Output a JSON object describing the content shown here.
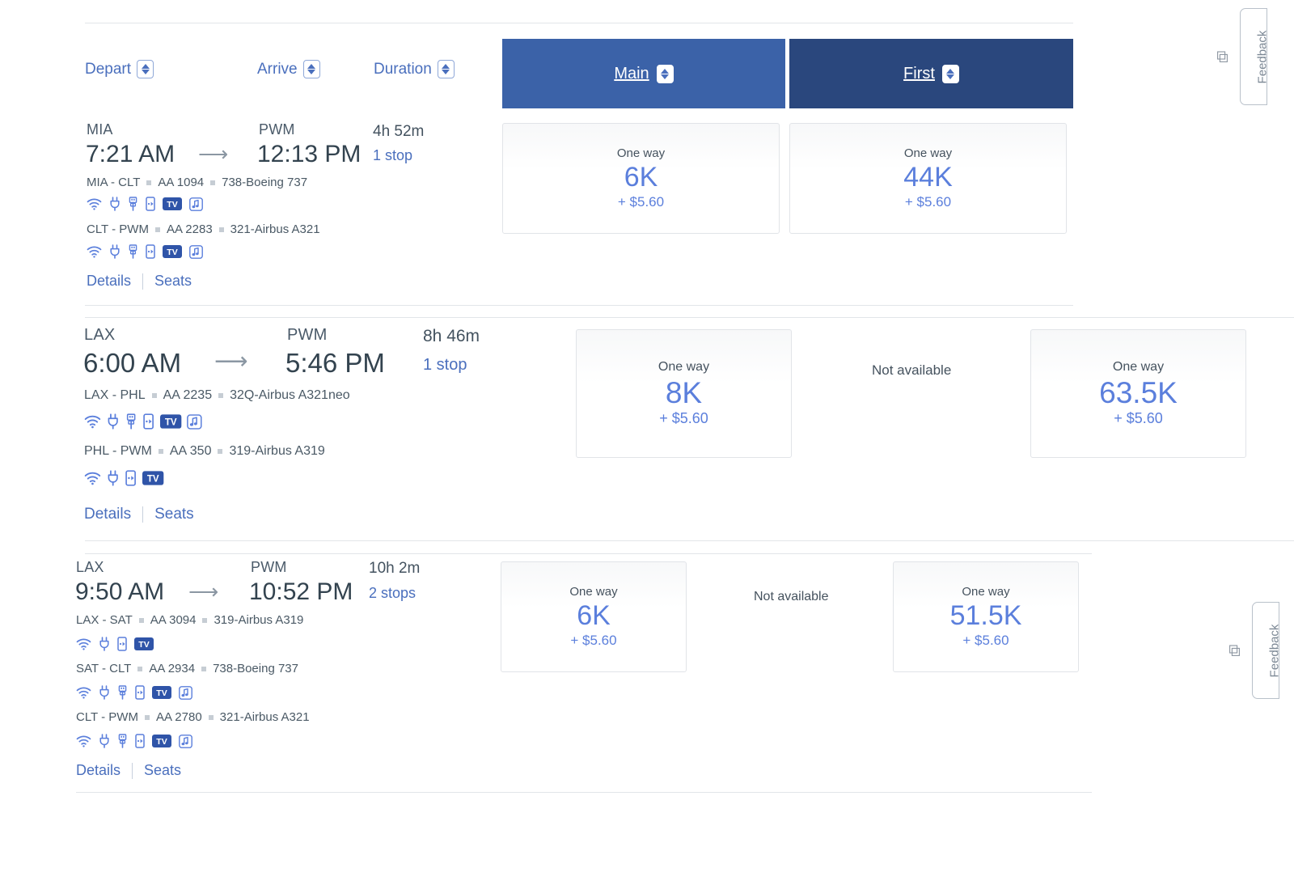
{
  "header": {
    "columns": [
      {
        "label": "Depart",
        "icon": "sort-icon"
      },
      {
        "label": "Arrive",
        "icon": "sort-icon"
      },
      {
        "label": "Duration",
        "icon": "sort-icon"
      }
    ],
    "cabins": [
      {
        "label": "Main",
        "color": "#3b62a8",
        "icon": "sort-icon"
      },
      {
        "label": "First",
        "color": "#2a477d",
        "icon": "sort-icon"
      }
    ]
  },
  "links": {
    "details": "Details",
    "seats": "Seats",
    "one_way": "One way",
    "not_available": "Not available"
  },
  "itineraries": [
    {
      "origin": "MIA",
      "depart_time": "7:21 AM",
      "destination": "PWM",
      "arrive_time": "12:13 PM",
      "duration": "4h 52m",
      "stops": "1 stop",
      "segments": [
        {
          "route": "MIA - CLT",
          "flight": "AA 1094",
          "aircraft": "738-Boeing 737",
          "amenities": [
            "wifi-icon",
            "power-outlet-icon",
            "usb-icon",
            "streaming-device-icon",
            "tv-icon",
            "music-icon"
          ]
        },
        {
          "route": "CLT - PWM",
          "flight": "AA 2283",
          "aircraft": "321-Airbus A321",
          "amenities": [
            "wifi-icon",
            "power-outlet-icon",
            "usb-icon",
            "streaming-device-icon",
            "tv-icon",
            "music-icon"
          ]
        }
      ],
      "fares": [
        {
          "cabin": "Main",
          "available": true,
          "label": "One way",
          "amount": "6K",
          "tax": "+ $5.60"
        },
        {
          "cabin": "First",
          "available": true,
          "label": "One way",
          "amount": "44K",
          "tax": "+ $5.60"
        }
      ]
    },
    {
      "origin": "LAX",
      "depart_time": "6:00 AM",
      "destination": "PWM",
      "arrive_time": "5:46 PM",
      "duration": "8h 46m",
      "stops": "1 stop",
      "segments": [
        {
          "route": "LAX - PHL",
          "flight": "AA 2235",
          "aircraft": "32Q-Airbus A321neo",
          "amenities": [
            "wifi-icon",
            "power-outlet-icon",
            "usb-icon",
            "streaming-device-icon",
            "tv-icon",
            "music-icon"
          ]
        },
        {
          "route": "PHL - PWM",
          "flight": "AA 350",
          "aircraft": "319-Airbus A319",
          "amenities": [
            "wifi-icon",
            "power-outlet-icon",
            "streaming-device-icon",
            "tv-icon"
          ]
        }
      ],
      "fares": [
        {
          "cabin": "Main",
          "available": true,
          "label": "One way",
          "amount": "8K",
          "tax": "+ $5.60"
        },
        {
          "cabin": "",
          "available": false,
          "label": "Not available"
        },
        {
          "cabin": "First",
          "available": true,
          "label": "One way",
          "amount": "63.5K",
          "tax": "+ $5.60"
        }
      ]
    },
    {
      "origin": "LAX",
      "depart_time": "9:50 AM",
      "destination": "PWM",
      "arrive_time": "10:52 PM",
      "duration": "10h 2m",
      "stops": "2 stops",
      "segments": [
        {
          "route": "LAX - SAT",
          "flight": "AA 3094",
          "aircraft": "319-Airbus A319",
          "amenities": [
            "wifi-icon",
            "power-outlet-icon",
            "streaming-device-icon",
            "tv-icon"
          ]
        },
        {
          "route": "SAT - CLT",
          "flight": "AA 2934",
          "aircraft": "738-Boeing 737",
          "amenities": [
            "wifi-icon",
            "power-outlet-icon",
            "usb-icon",
            "streaming-device-icon",
            "tv-icon",
            "music-icon"
          ]
        },
        {
          "route": "CLT - PWM",
          "flight": "AA 2780",
          "aircraft": "321-Airbus A321",
          "amenities": [
            "wifi-icon",
            "power-outlet-icon",
            "usb-icon",
            "streaming-device-icon",
            "tv-icon",
            "music-icon"
          ]
        }
      ],
      "fares": [
        {
          "cabin": "Main",
          "available": true,
          "label": "One way",
          "amount": "6K",
          "tax": "+ $5.60"
        },
        {
          "cabin": "",
          "available": false,
          "label": "Not available"
        },
        {
          "cabin": "First",
          "available": true,
          "label": "One way",
          "amount": "51.5K",
          "tax": "+ $5.60"
        }
      ]
    }
  ],
  "feedback": [
    {
      "label": "Feedback",
      "icon": "external-link-icon"
    },
    {
      "label": "Feedback",
      "icon": "external-link-icon"
    }
  ]
}
